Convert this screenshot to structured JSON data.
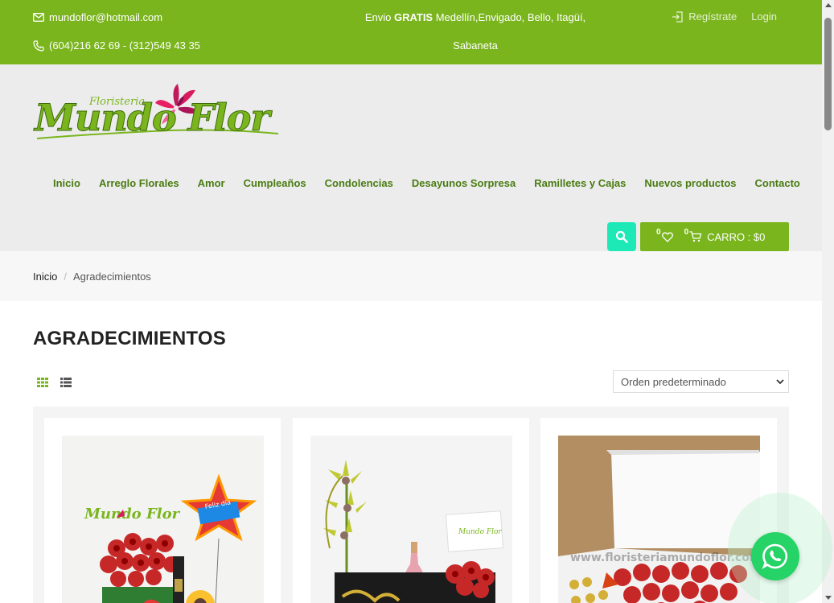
{
  "topbar": {
    "email": "mundoflor@hotmail.com",
    "phone": "(604)216 62 69 - (312)549 43 35",
    "shipping_prefix": "Envio ",
    "shipping_bold": "GRATIS",
    "shipping_line1": " Medellín,Envigado, Bello, Itagüí,",
    "shipping_line2": "Sabaneta",
    "register_label": "Regístrate",
    "login_label": "Login"
  },
  "logo": {
    "small_text": "Floristeria",
    "main_text": "Mundo Flor"
  },
  "nav": {
    "items": [
      {
        "label": "Inicio"
      },
      {
        "label": "Arreglo Florales"
      },
      {
        "label": "Amor"
      },
      {
        "label": "Cumpleaños"
      },
      {
        "label": "Condolencias"
      },
      {
        "label": "Desayunos Sorpresa"
      },
      {
        "label": "Ramilletes y Cajas"
      },
      {
        "label": "Nuevos productos"
      },
      {
        "label": "Contacto"
      }
    ]
  },
  "cart": {
    "wishlist_count": "0",
    "cart_count": "0",
    "label": "CARRO : $0"
  },
  "breadcrumb": {
    "home": "Inicio",
    "separator": "/",
    "current": "Agradecimientos"
  },
  "page": {
    "title": "AGRADECIMIENTOS",
    "sort_selected": "Orden predeterminado"
  },
  "products": [
    {
      "image": "arreglo-rosas-rojas-globo-feliz-dia",
      "logo_text": "Mundo Flor",
      "balloon_text": "Feliz día"
    },
    {
      "image": "caja-orquideas-champana-rosas",
      "card_text": "Mundo Flor"
    },
    {
      "image": "caja-blanca-rosas-rojas-chocolates",
      "watermark": "www.floristeriamundoflor.com"
    }
  ],
  "colors": {
    "brand_green": "#7ab51d",
    "nav_green": "#4a7c12",
    "search_teal": "#1de9b6",
    "whatsapp_green": "#25d366"
  }
}
